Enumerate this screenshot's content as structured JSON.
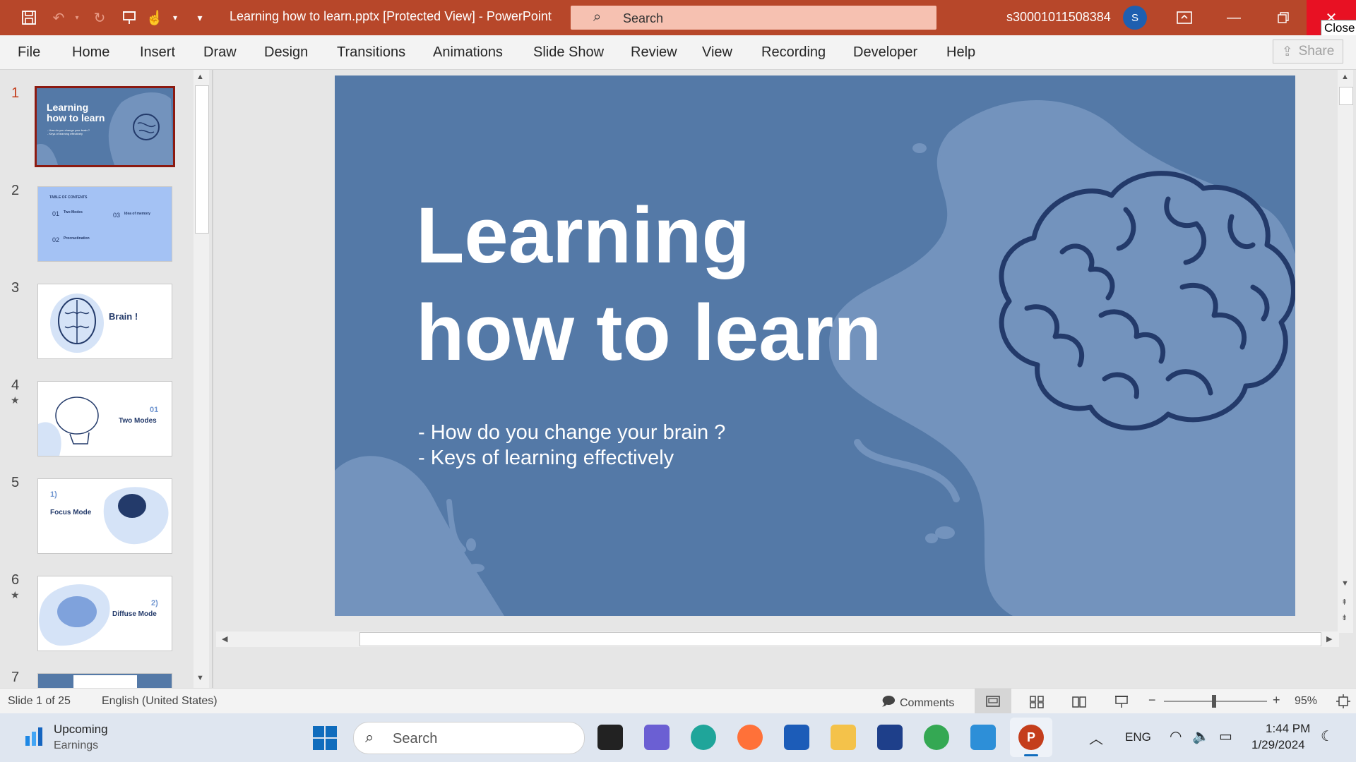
{
  "app": {
    "doc_title": "Learning how to learn.pptx [Protected View]  -  PowerPoint",
    "search_placeholder": "Search",
    "account_name": "s30001011508384",
    "avatar_initial": "S",
    "close_tooltip": "Close",
    "accent_color": "#b7472a"
  },
  "ribbon": {
    "tabs": [
      "File",
      "Home",
      "Insert",
      "Draw",
      "Design",
      "Transitions",
      "Animations",
      "Slide Show",
      "Review",
      "View",
      "Recording",
      "Developer",
      "Help"
    ],
    "share_label": "Share"
  },
  "thumbnails": {
    "numbers": [
      "1",
      "2",
      "3",
      "4",
      "5",
      "6",
      "7"
    ],
    "t1_title_1": "Learning",
    "t1_title_2": "how to learn",
    "t1_sub_1": "- How do you change your brain ?",
    "t1_sub_2": "- Keys of learning effectively",
    "t2_heading": "TABLE OF CONTENTS",
    "t2_n1": "01",
    "t2_l1": "Two Modes",
    "t2_n2": "02",
    "t2_l2": "Procrastination",
    "t2_n3": "03",
    "t2_l3": "Idea of memory",
    "t3_title": "Brain !",
    "t4_num": "01",
    "t4_title": "Two Modes",
    "t5_num": "1)",
    "t5_title": "Focus Mode",
    "t6_num": "2)",
    "t6_title": "Diffuse Mode"
  },
  "slide": {
    "title_line1": "Learning",
    "title_line2": "how to learn",
    "bullet1": "- How do you change your brain ?",
    "bullet2": "- Keys of learning effectively",
    "background": "#5479a7"
  },
  "status": {
    "slide_info": "Slide 1 of 25",
    "language": "English (United States)",
    "comments_label": "Comments",
    "zoom_minus": "−",
    "zoom_plus": "+",
    "zoom_level": "95%"
  },
  "taskbar": {
    "widget_title": "Upcoming",
    "widget_sub": "Earnings",
    "search_placeholder": "Search",
    "lang": "ENG",
    "time": "1:44 PM",
    "date": "1/29/2024"
  }
}
